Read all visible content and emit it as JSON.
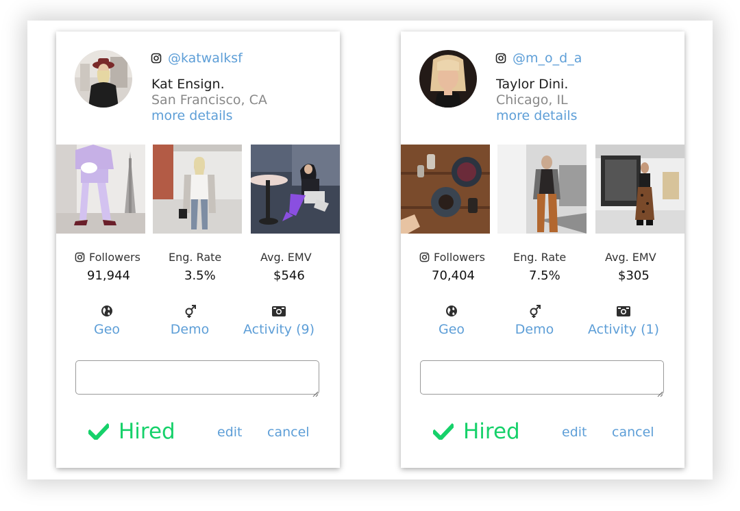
{
  "cards": [
    {
      "handle": "@katwalksf",
      "name": "Kat Ensign.",
      "location": "San Francisco, CA",
      "more_details": "more details",
      "stats": [
        {
          "label": "Followers",
          "value": "91,944"
        },
        {
          "label": "Eng. Rate",
          "value": "3.5%"
        },
        {
          "label": "Avg. EMV",
          "value": "$546"
        }
      ],
      "actions": [
        {
          "icon": "globe-icon",
          "label": "Geo"
        },
        {
          "icon": "gender-icon",
          "label": "Demo"
        },
        {
          "icon": "camera-icon",
          "label": "Activity (9)"
        }
      ],
      "notes_value": "",
      "status": "Hired",
      "edit_label": "edit",
      "cancel_label": "cancel"
    },
    {
      "handle": "@m_o_d_a",
      "name": "Taylor Dini.",
      "location": "Chicago, IL",
      "more_details": "more details",
      "stats": [
        {
          "label": "Followers",
          "value": "70,404"
        },
        {
          "label": "Eng. Rate",
          "value": "7.5%"
        },
        {
          "label": "Avg. EMV",
          "value": "$305"
        }
      ],
      "actions": [
        {
          "icon": "globe-icon",
          "label": "Geo"
        },
        {
          "icon": "gender-icon",
          "label": "Demo"
        },
        {
          "icon": "camera-icon",
          "label": "Activity (1)"
        }
      ],
      "notes_value": "",
      "status": "Hired",
      "edit_label": "edit",
      "cancel_label": "cancel"
    }
  ],
  "colors": {
    "link": "#5d9ed7",
    "hired": "#16d16a",
    "text": "#1e1e1e",
    "muted": "#888888"
  }
}
